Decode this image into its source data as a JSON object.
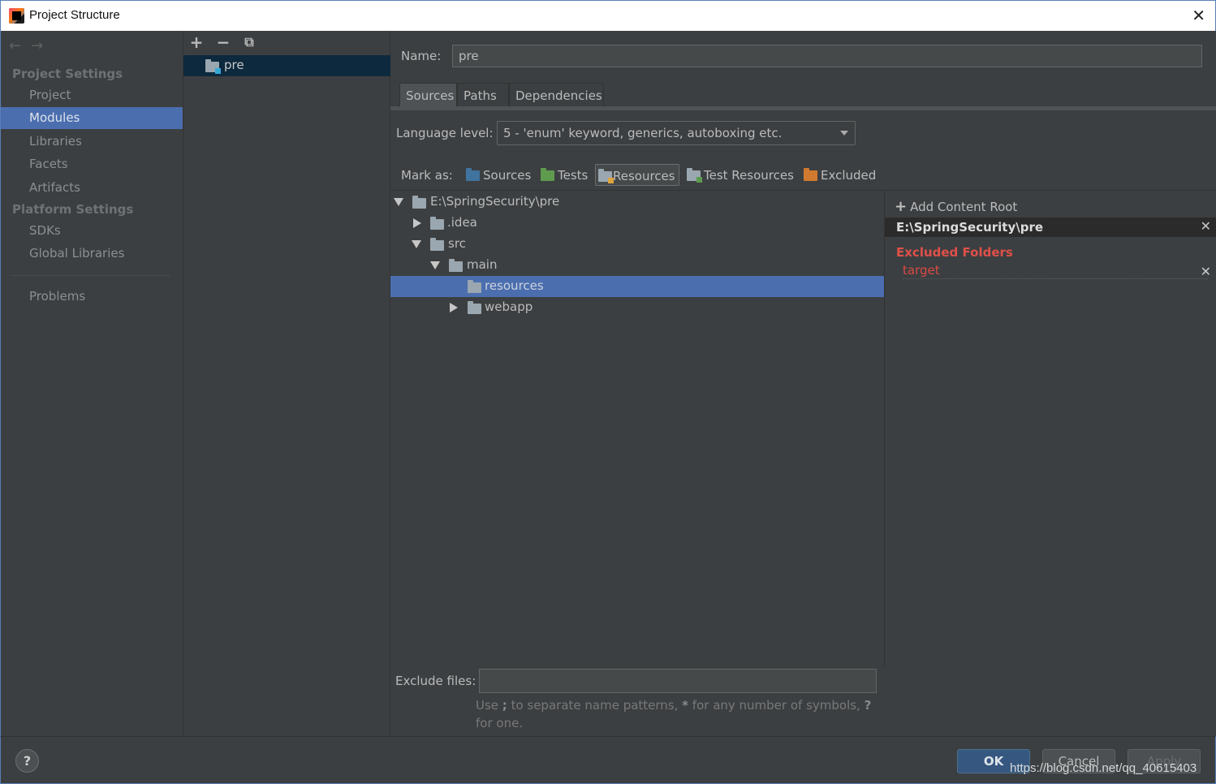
{
  "window": {
    "title": "Project Structure"
  },
  "nav": {
    "project_settings": "Project Settings",
    "platform_settings": "Platform Settings",
    "items": [
      "Project",
      "Modules",
      "Libraries",
      "Facets",
      "Artifacts"
    ],
    "platform_items": [
      "SDKs",
      "Global Libraries"
    ],
    "problems": "Problems",
    "selected": "Modules"
  },
  "modules": {
    "items": [
      "pre"
    ]
  },
  "main": {
    "name_label": "Name:",
    "name_value": "pre",
    "tabs": [
      "Sources",
      "Paths",
      "Dependencies"
    ],
    "active_tab": "Sources",
    "language_level_label": "Language level:",
    "language_level_value": "5 - 'enum' keyword, generics, autoboxing etc.",
    "mark_as_label": "Mark as:",
    "mark_as": [
      "Sources",
      "Tests",
      "Resources",
      "Test Resources",
      "Excluded"
    ],
    "mark_as_pressed": "Resources",
    "tree": [
      {
        "label": "E:\\SpringSecurity\\pre",
        "expanded": true
      },
      {
        "label": ".idea",
        "expanded": false
      },
      {
        "label": "src",
        "expanded": true
      },
      {
        "label": "main",
        "expanded": true
      },
      {
        "label": "resources",
        "selected": true
      },
      {
        "label": "webapp",
        "expanded": false
      }
    ],
    "exclude_files_label": "Exclude files:",
    "exclude_files_value": "",
    "hint": {
      "part1": "Use ",
      "semi": ";",
      "part2": " to separate name patterns, ",
      "star": "*",
      "part3": " for any number of symbols, ",
      "q": "?",
      "part4": " for one."
    }
  },
  "roots": {
    "add_content_root": "Add Content Root",
    "root_path": "E:\\SpringSecurity\\pre",
    "excluded_folders_title": "Excluded Folders",
    "excluded_folders": [
      "target"
    ]
  },
  "footer": {
    "help": "?",
    "ok": "OK",
    "cancel": "Cancel",
    "apply": "Apply",
    "watermark": "https://blog.csdn.net/qq_40615403"
  },
  "colors": {
    "background": "#3c3f41",
    "selection": "#4b6eaf",
    "excluded": "#e0504a",
    "ok_button": "#365880"
  }
}
